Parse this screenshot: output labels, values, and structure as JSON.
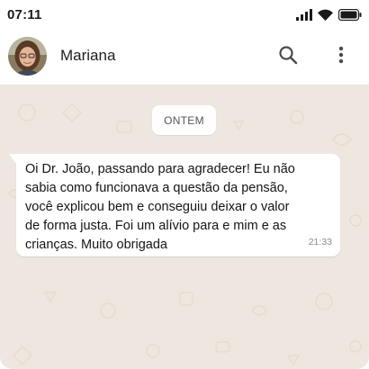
{
  "status_bar": {
    "time": "07:11",
    "icons": [
      "signal-icon",
      "wifi-icon",
      "battery-icon"
    ]
  },
  "header": {
    "contact_name": "Mariana",
    "avatar_icon": "avatar",
    "actions": [
      "search-icon",
      "more-vert-icon"
    ]
  },
  "chat": {
    "date_label": "ONTEM",
    "messages": [
      {
        "text": "Oi Dr. João, passando para agradecer! Eu não sabia como funcionava a questão da pensão, você explicou bem e conseguiu deixar o valor de forma justa. Foi um alívio para e mim e as crianças. Muito obrigada",
        "time": "21:33"
      }
    ]
  },
  "colors": {
    "chat_background": "#ede7df",
    "bubble": "#ffffff",
    "header": "#ffffff"
  }
}
